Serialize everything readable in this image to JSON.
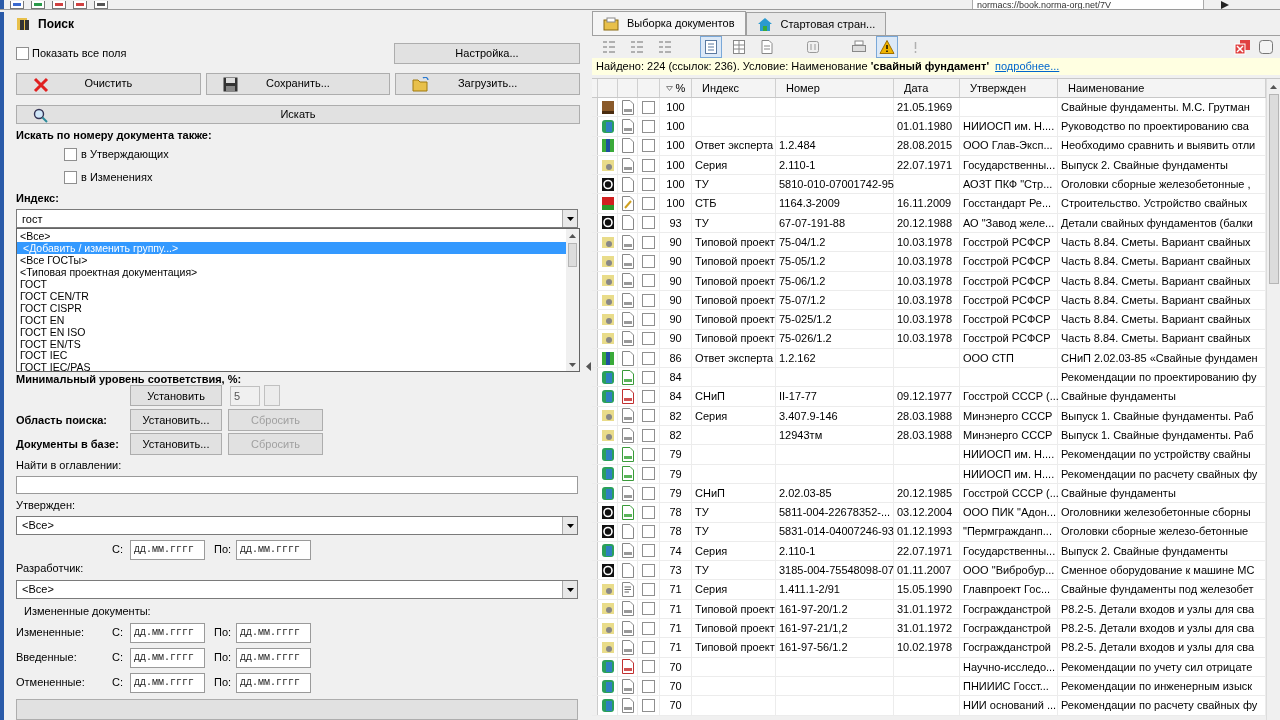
{
  "address": "normacs://book.norma-org.net/7V",
  "search_panel": {
    "title": "Поиск",
    "show_all_fields": {
      "label": "Показать все поля",
      "checked": false
    },
    "settings_button": "Настройка...",
    "action_buttons": [
      {
        "kind": "clear",
        "label": "Очистить"
      },
      {
        "kind": "save",
        "label": "Сохранить..."
      },
      {
        "kind": "load",
        "label": "Загрузить..."
      }
    ],
    "search_button": "Искать",
    "number_search": {
      "label": "Искать по номеру документа также:",
      "options": [
        {
          "label": "в Утверждающих",
          "checked": false
        },
        {
          "label": "в Изменениях",
          "checked": false
        }
      ]
    },
    "index": {
      "label": "Индекс:",
      "value": "гост",
      "options": [
        {
          "label": "<Все>",
          "selected": false
        },
        {
          "label": "<Добавить / изменить группу...>",
          "selected": true
        },
        {
          "label": "<Все ГОСТы>",
          "selected": false
        },
        {
          "label": "<Типовая проектная документация>",
          "selected": false
        },
        {
          "label": "ГОСТ",
          "selected": false
        },
        {
          "label": "ГОСТ CEN/TR",
          "selected": false
        },
        {
          "label": "ГОСТ CISPR",
          "selected": false
        },
        {
          "label": "ГОСТ EN",
          "selected": false
        },
        {
          "label": "ГОСТ EN ISO",
          "selected": false
        },
        {
          "label": "ГОСТ EN/TS",
          "selected": false
        },
        {
          "label": "ГОСТ IEC",
          "selected": false
        },
        {
          "label": "ГОСТ IEC/PAS",
          "selected": false
        }
      ]
    },
    "min_level": {
      "label": "Минимальный уровень соответствия, %:",
      "button": "Установить",
      "value": "5"
    },
    "scope": [
      {
        "label": "Область поиска:",
        "set_button": "Установить...",
        "reset_button": "Сбросить",
        "reset_disabled": true
      },
      {
        "label": "Документы в базе:",
        "set_button": "Установить...",
        "reset_button": "Сбросить",
        "reset_disabled": true
      }
    ],
    "toc": {
      "label": "Найти в оглавлении:"
    },
    "approved": {
      "label": "Утвержден:",
      "value": "<Все>",
      "from_label": "С:",
      "from_placeholder": "дд.мм.гггг",
      "to_label": "По:",
      "to_placeholder": "дд.мм.гггг"
    },
    "developer": {
      "label": "Разработчик:",
      "value": "<Все>"
    },
    "changed_docs": {
      "title": "Измененные документы:",
      "rows": [
        {
          "label": "Измененные:",
          "from_label": "С:",
          "from_placeholder": "дд.мм.гггг",
          "to_label": "По:",
          "to_placeholder": "дд.мм.гггг"
        },
        {
          "label": "Введенные:",
          "from_label": "С:",
          "from_placeholder": "дд.мм.гггг",
          "to_label": "По:",
          "to_placeholder": "дд.мм.гггг"
        },
        {
          "label": "Отмененные:",
          "from_label": "С:",
          "from_placeholder": "дд.мм.гггг",
          "to_label": "По:",
          "to_placeholder": "дд.мм.гггг"
        }
      ]
    }
  },
  "tabs": [
    {
      "kind": "docs",
      "label": "Выборка документов",
      "selected": true
    },
    {
      "kind": "home",
      "label": "Стартовая стран...",
      "selected": false
    }
  ],
  "toolbar": [
    {
      "kind": "grid",
      "selected": false
    },
    {
      "kind": "grid",
      "selected": false
    },
    {
      "kind": "grid",
      "selected": false
    },
    {
      "kind": "list",
      "selected": true
    },
    {
      "kind": "table",
      "selected": false
    },
    {
      "kind": "page",
      "selected": false
    },
    {
      "kind": "columns",
      "selected": false
    },
    {
      "kind": "print",
      "selected": false
    },
    {
      "kind": "warning",
      "selected": true
    },
    {
      "kind": "exclaim",
      "selected": false
    }
  ],
  "info": {
    "text": "Найдено: 224 (ссылок: 236). Условие: Наименование **'свайный фундамент'**",
    "link": "подробнее..."
  },
  "columns": [
    {
      "label": "%",
      "sorted": true
    },
    {
      "label": "Индекс",
      "sorted": false
    },
    {
      "label": "Номер",
      "sorted": false
    },
    {
      "label": "Дата",
      "sorted": false
    },
    {
      "label": "Утвержден",
      "sorted": false
    },
    {
      "label": "Наименование",
      "sorted": false
    }
  ],
  "rows": [
    {
      "kind": "book",
      "doc": {
        "kind": "lined"
      },
      "checked": false,
      "score": "100",
      "index": "",
      "number": "",
      "date": "21.05.1969",
      "approved": "",
      "name": "Свайные фундаменты. М.С. Грутман"
    },
    {
      "kind": "norm",
      "doc": {
        "kind": "lined"
      },
      "checked": false,
      "score": "100",
      "index": "",
      "number": "",
      "date": "01.01.1980",
      "approved": "НИИОСП им. Н....",
      "name": "Руководство по проектированию сва"
    },
    {
      "kind": "expert",
      "doc": {
        "kind": "plain"
      },
      "checked": false,
      "score": "100",
      "index": "Ответ эксперта",
      "number": "1.2.484",
      "date": "28.08.2015",
      "approved": "ООО Глав-Эксп...",
      "name": "Необходимо сравнить и выявить отли"
    },
    {
      "kind": "series",
      "doc": {
        "kind": "lined"
      },
      "checked": false,
      "score": "100",
      "index": "Серия",
      "number": "2.110-1",
      "date": "22.07.1971",
      "approved": "Государственны...",
      "name": "Выпуск 2. Свайные фундаменты"
    },
    {
      "kind": "tu",
      "doc": {
        "kind": "plain"
      },
      "checked": false,
      "score": "100",
      "index": "ТУ",
      "number": "5810-010-07001742-95",
      "date": "",
      "approved": "АОЗТ ПКФ \"Стр...",
      "name": "Оголовки сборные железобетонные ,"
    },
    {
      "kind": "stb",
      "doc": {
        "kind": "edit"
      },
      "checked": false,
      "score": "100",
      "index": "СТБ",
      "number": "1164.3-2009",
      "date": "16.11.2009",
      "approved": "Госстандарт Ре...",
      "name": "Строительство. Устройство свайных"
    },
    {
      "kind": "tu",
      "doc": {
        "kind": "plain"
      },
      "checked": false,
      "score": "93",
      "index": "ТУ",
      "number": "67-07-191-88",
      "date": "20.12.1988",
      "approved": "АО \"Завод желе...",
      "name": "Детали свайных фундаментов (балки"
    },
    {
      "kind": "series",
      "doc": {
        "kind": "lined"
      },
      "checked": false,
      "score": "90",
      "index": "Типовой проект",
      "number": "75-04/1.2",
      "date": "10.03.1978",
      "approved": "Госстрой РСФСР",
      "name": "Часть 8.84. Сметы. Вариант свайных"
    },
    {
      "kind": "series",
      "doc": {
        "kind": "lined"
      },
      "checked": false,
      "score": "90",
      "index": "Типовой проект",
      "number": "75-05/1.2",
      "date": "10.03.1978",
      "approved": "Госстрой РСФСР",
      "name": "Часть 8.84. Сметы. Вариант свайных"
    },
    {
      "kind": "series",
      "doc": {
        "kind": "lined"
      },
      "checked": false,
      "score": "90",
      "index": "Типовой проект",
      "number": "75-06/1.2",
      "date": "10.03.1978",
      "approved": "Госстрой РСФСР",
      "name": "Часть 8.84. Сметы. Вариант свайных"
    },
    {
      "kind": "series",
      "doc": {
        "kind": "lined"
      },
      "checked": false,
      "score": "90",
      "index": "Типовой проект",
      "number": "75-07/1.2",
      "date": "10.03.1978",
      "approved": "Госстрой РСФСР",
      "name": "Часть 8.84. Сметы. Вариант свайных"
    },
    {
      "kind": "series",
      "doc": {
        "kind": "lined"
      },
      "checked": false,
      "score": "90",
      "index": "Типовой проект",
      "number": "75-025/1.2",
      "date": "10.03.1978",
      "approved": "Госстрой РСФСР",
      "name": "Часть 8.84. Сметы. Вариант свайных"
    },
    {
      "kind": "series",
      "doc": {
        "kind": "lined"
      },
      "checked": false,
      "score": "90",
      "index": "Типовой проект",
      "number": "75-026/1.2",
      "date": "10.03.1978",
      "approved": "Госстрой РСФСР",
      "name": "Часть 8.84. Сметы. Вариант свайных"
    },
    {
      "kind": "expert",
      "doc": {
        "kind": "plain"
      },
      "checked": false,
      "score": "86",
      "index": "Ответ эксперта",
      "number": "1.2.162",
      "date": "",
      "approved": "ООО СТП",
      "name": "СНиП 2.02.03-85 «Свайные фундамен"
    },
    {
      "kind": "norm",
      "doc": {
        "kind": "green"
      },
      "checked": false,
      "score": "84",
      "index": "",
      "number": "",
      "date": "",
      "approved": "",
      "name": "Рекомендации по проектированию фу"
    },
    {
      "kind": "norm",
      "doc": {
        "kind": "red"
      },
      "checked": false,
      "score": "84",
      "index": "СНиП",
      "number": "II-17-77",
      "date": "09.12.1977",
      "approved": "Госстрой СССР (...",
      "name": "Свайные фундаменты"
    },
    {
      "kind": "series",
      "doc": {
        "kind": "lined"
      },
      "checked": false,
      "score": "82",
      "index": "Серия",
      "number": "3.407.9-146",
      "date": "28.03.1988",
      "approved": "Минэнерго СССР",
      "name": "Выпуск 1. Свайные фундаменты. Раб"
    },
    {
      "kind": "series",
      "doc": {
        "kind": "lined"
      },
      "checked": false,
      "score": "82",
      "index": "",
      "number": "12943тм",
      "date": "28.03.1988",
      "approved": "Минэнерго СССР",
      "name": "Выпуск 1. Свайные фундаменты. Раб"
    },
    {
      "kind": "norm",
      "doc": {
        "kind": "green"
      },
      "checked": false,
      "score": "79",
      "index": "",
      "number": "",
      "date": "",
      "approved": "НИИОСП им. Н....",
      "name": "Рекомендации по устройству свайны"
    },
    {
      "kind": "norm",
      "doc": {
        "kind": "green"
      },
      "checked": false,
      "score": "79",
      "index": "",
      "number": "",
      "date": "",
      "approved": "НИИОСП им. Н....",
      "name": "Рекомендации по расчету свайных фу"
    },
    {
      "kind": "norm",
      "doc": {
        "kind": "lined"
      },
      "checked": false,
      "score": "79",
      "index": "СНиП",
      "number": "2.02.03-85",
      "date": "20.12.1985",
      "approved": "Госстрой СССР (...",
      "name": "Свайные фундаменты"
    },
    {
      "kind": "tu",
      "doc": {
        "kind": "green"
      },
      "checked": false,
      "score": "78",
      "index": "ТУ",
      "number": "5811-004-22678352-...",
      "date": "03.12.2004",
      "approved": "ООО ПИК \"Адон...",
      "name": "Оголовники железобетонные сборны"
    },
    {
      "kind": "tu",
      "doc": {
        "kind": "plain"
      },
      "checked": false,
      "score": "78",
      "index": "ТУ",
      "number": "5831-014-04007246-93",
      "date": "01.12.1993",
      "approved": "\"Пермгражданп...",
      "name": "Оголовки сборные железо-бетонные"
    },
    {
      "kind": "norm",
      "doc": {
        "kind": "lined"
      },
      "checked": false,
      "score": "74",
      "index": "Серия",
      "number": "2.110-1",
      "date": "22.07.1971",
      "approved": "Государственны...",
      "name": "Выпуск 2. Свайные фундаменты"
    },
    {
      "kind": "tu",
      "doc": {
        "kind": "plain"
      },
      "checked": false,
      "score": "73",
      "index": "ТУ",
      "number": "3185-004-75548098-07",
      "date": "01.11.2007",
      "approved": "ООО \"Вибробур...",
      "name": "Сменное оборудование к машине МС"
    },
    {
      "kind": "series",
      "doc": {
        "kind": "text"
      },
      "checked": false,
      "score": "71",
      "index": "Серия",
      "number": "1.411.1-2/91",
      "date": "15.05.1990",
      "approved": "Главпроект Гос...",
      "name": "Свайные фундаменты под железобет"
    },
    {
      "kind": "series",
      "doc": {
        "kind": "lined"
      },
      "checked": false,
      "score": "71",
      "index": "Типовой проект",
      "number": "161-97-20/1.2",
      "date": "31.01.1972",
      "approved": "Госгражданстрой",
      "name": "Р8.2-5. Детали входов и узлы для сва"
    },
    {
      "kind": "series",
      "doc": {
        "kind": "lined"
      },
      "checked": false,
      "score": "71",
      "index": "Типовой проект",
      "number": "161-97-21/1,2",
      "date": "31.01.1972",
      "approved": "Госгражданстрой",
      "name": "Р8.2-5. Детали входов и узлы для сва"
    },
    {
      "kind": "series",
      "doc": {
        "kind": "lined"
      },
      "checked": false,
      "score": "71",
      "index": "Типовой проект",
      "number": "161-97-56/1.2",
      "date": "10.02.1978",
      "approved": "Госгражданстрой",
      "name": "Р8.2-5. Детали входов и узлы для сва"
    },
    {
      "kind": "norm",
      "doc": {
        "kind": "red"
      },
      "checked": false,
      "score": "70",
      "index": "",
      "number": "",
      "date": "",
      "approved": "Научно-исследо...",
      "name": "Рекомендации по учету сил отрицате"
    },
    {
      "kind": "norm",
      "doc": {
        "kind": "lined"
      },
      "checked": false,
      "score": "70",
      "index": "",
      "number": "",
      "date": "",
      "approved": "ПНИИИС Госст...",
      "name": "Рекомендации по инженерным изыск"
    },
    {
      "kind": "norm",
      "doc": {
        "kind": "lined"
      },
      "checked": false,
      "score": "70",
      "index": "",
      "number": "",
      "date": "",
      "approved": "НИИ оснований ...",
      "name": "Рекомендации по расчету свайных фу"
    }
  ]
}
